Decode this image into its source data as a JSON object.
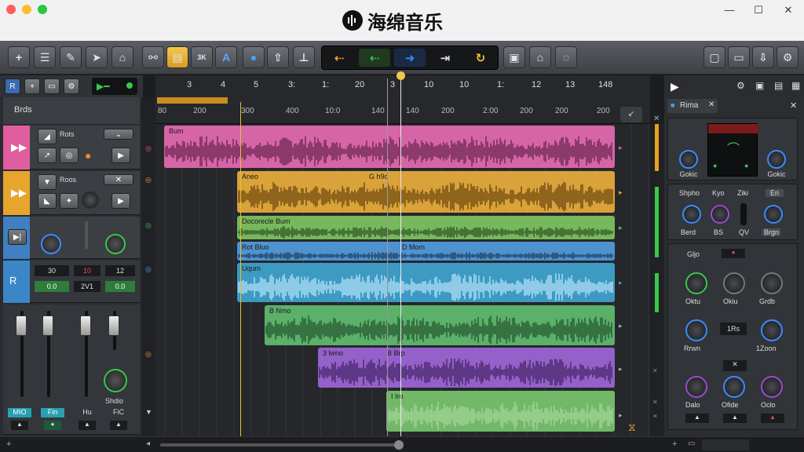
{
  "app": {
    "name": "海绵音乐",
    "logo_icon": "waveform-logo-icon"
  },
  "window_controls": {
    "traffic_lights": [
      "#ff5f57",
      "#febc2e",
      "#28c840"
    ],
    "minimize": "—",
    "maximize": "☐",
    "close": "✕"
  },
  "toolbar": {
    "left_tools": [
      "add-icon",
      "list-icon",
      "pencil-icon",
      "select-icon",
      "cut-icon",
      "link-icon",
      "layers-icon",
      "grid-icon",
      "text-icon",
      "bulb-icon",
      "up-arrow-icon",
      "split-icon"
    ],
    "transport": [
      "rewind-icon",
      "back-icon",
      "forward-icon",
      "next-icon",
      "loop-icon"
    ],
    "right_tools": [
      "window-icon",
      "save-icon",
      "export-icon",
      "settings-icon"
    ]
  },
  "timeline": {
    "bars": [
      "3",
      "4",
      "5",
      "3:",
      "1:",
      "20",
      "3",
      "10",
      "10",
      "1:",
      "12",
      "13",
      "148"
    ],
    "timecodes": [
      "80",
      "200",
      "300",
      "400",
      "10:0",
      "140",
      "140",
      "200",
      "2:00",
      "200",
      "200",
      "200"
    ],
    "tracks_label": "Brds"
  },
  "tracks": [
    {
      "name": "Rots",
      "color": "#e05ea0"
    },
    {
      "name": "Roos",
      "color": "#e7a52d"
    },
    {
      "name": "",
      "color": "#3f7fc2"
    },
    {
      "name": "",
      "color": "#3b86c7"
    }
  ],
  "mixer": {
    "row1": [
      "30",
      "10",
      "12"
    ],
    "row2": [
      "0.0",
      "2V1",
      "0.0"
    ],
    "fader_labels": [
      "MIO",
      "Fin",
      "Hu",
      "FiC"
    ],
    "knob_label": "Shdio"
  },
  "clips": [
    {
      "name": "Bum",
      "name2": "",
      "color": "#d665a7",
      "wave": "#5a1d44"
    },
    {
      "name": "Aneo",
      "name2": "G h9o",
      "color": "#d9a23a",
      "wave": "#5e3d0a"
    },
    {
      "name": "Docorecle Bum",
      "name2": "",
      "color": "#77b85c",
      "wave": "#25461b"
    },
    {
      "name": "Rot Bluo",
      "name2": "D Mom",
      "color": "#4f92d0",
      "wave": "#16324d"
    },
    {
      "name": "Uqum",
      "name2": "",
      "color": "#3d9ac2",
      "wave": "#c6ecff"
    },
    {
      "name": "B Nmo",
      "name2": "",
      "color": "#5bb06a",
      "wave": "#1f4a27"
    },
    {
      "name": "3 lwno",
      "name2": "B Brp",
      "color": "#9460c9",
      "wave": "#3b1e5b"
    },
    {
      "name": "I Iro",
      "name2": "",
      "color": "#72b868",
      "wave": "#acd9a2"
    }
  ],
  "right_panel": {
    "tab": "Rima",
    "left_knob": "Gokic",
    "right_knob": "Gokic",
    "row_labels": [
      "Shpho",
      "Kyo",
      "Ziki",
      "Eri"
    ],
    "row_knobs": [
      "Berd",
      "BS",
      "QV",
      "Brgn"
    ],
    "eq_title": "Gljo",
    "eq_knobs": [
      "Oktu",
      "Okiu",
      "Grdb"
    ],
    "mid_knobs": [
      "Rrwn",
      "1Rs",
      "1Zoon"
    ],
    "bot_knobs": [
      "Dalo",
      "Ofide",
      "Oclo"
    ]
  }
}
